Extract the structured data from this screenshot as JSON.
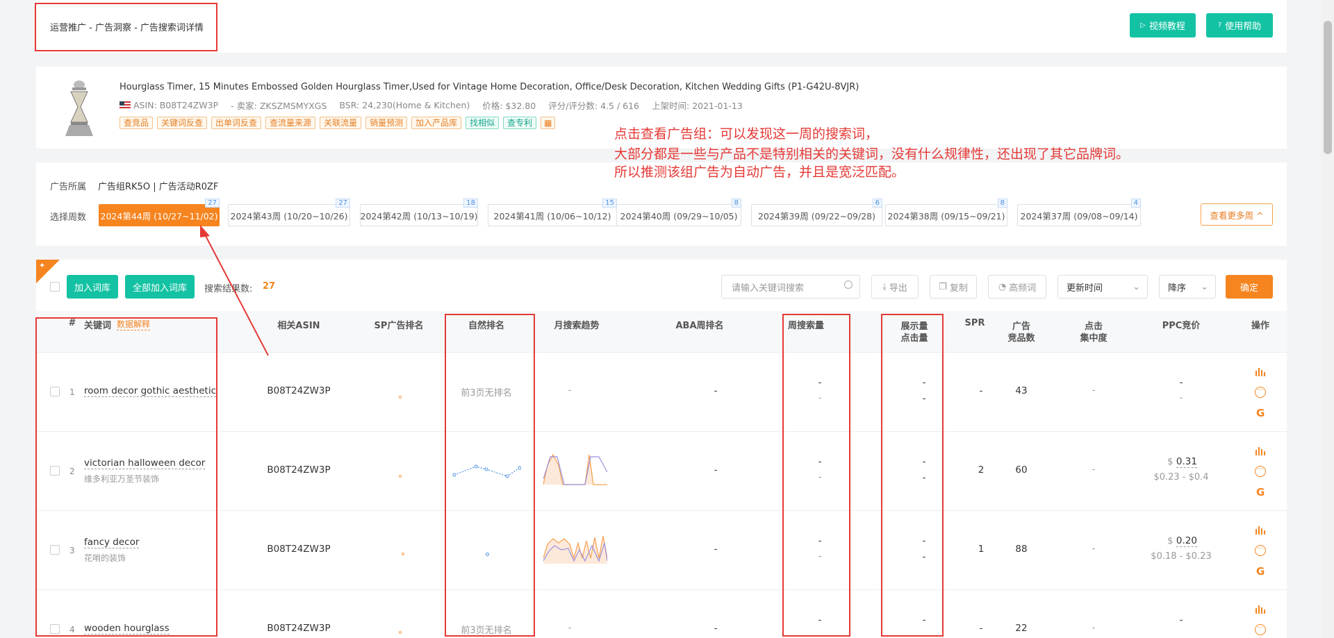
{
  "breadcrumb": "运营推广 - 广告洞察 - 广告搜索词详情",
  "header": {
    "video_btn": "视频教程",
    "help_btn": "使用帮助"
  },
  "product": {
    "title": "Hourglass Timer, 15 Minutes Embossed Golden Hourglass Timer,Used for Vintage Home Decoration, Office/Desk Decoration, Kitchen Wedding Gifts (P1-G42U-8VJR)",
    "asin": "ASIN: B08T24ZW3P",
    "seller": "- 卖家: ZKSZMSMYXGS",
    "bsr": "BSR: 24,230(Home & Kitchen)",
    "price": "价格: $32.80",
    "rating": "评分/评分数: 4.5 / 616",
    "listed": "上架时间: 2021-01-13",
    "tags": [
      "查竞品",
      "关键词反查",
      "出单词反查",
      "查流量来源",
      "关联流量",
      "销量预测",
      "加入产品库"
    ],
    "tags_green": [
      "找相似",
      "查专利"
    ]
  },
  "annotation": {
    "line1": "点击查看广告组：可以发现这一周的搜索词，",
    "line2": "大部分都是一些与产品不是特别相关的关键词，没有什么规律性，还出现了其它品牌词。",
    "line3": "所以推测该组广告为自动广告，并且是宽泛匹配。"
  },
  "ad": {
    "belong_label": "广告所属",
    "belong_value": "广告组RK5O | 广告活动R0ZF",
    "week_label": "选择周数",
    "weeks": [
      {
        "label": "2024第44周 (10/27~11/02)",
        "badge": "27"
      },
      {
        "label": "2024第43周 (10/20~10/26)",
        "badge": "27"
      },
      {
        "label": "2024第42周 (10/13~10/19)",
        "badge": "18"
      },
      {
        "label": "2024第41周 (10/06~10/12)",
        "badge": "15"
      },
      {
        "label": "2024第40周 (09/29~10/05)",
        "badge": "8"
      },
      {
        "label": "2024第39周 (09/22~09/28)",
        "badge": "6"
      },
      {
        "label": "2024第38周 (09/15~09/21)",
        "badge": "8"
      },
      {
        "label": "2024第37周 (09/08~09/14)",
        "badge": "4"
      }
    ],
    "more_weeks": "查看更多周 ^"
  },
  "toolbar": {
    "add_lib": "加入词库",
    "add_all": "全部加入词库",
    "result_label": "搜索结果数:",
    "result_count": "27",
    "search_placeholder": "请输入关键词搜索",
    "export": "导出",
    "copy": "复制",
    "high_freq": "高频词",
    "sort_field": "更新时间",
    "sort_order": "降序",
    "confirm": "确定"
  },
  "table": {
    "headers": {
      "idx": "#",
      "keyword": "关键词",
      "explain": "数据解释",
      "asin": "相关ASIN",
      "sp": "SP广告排名",
      "natural": "自然排名",
      "trend": "月搜索趋势",
      "aba": "ABA周排名",
      "weekly": "周搜索量",
      "impr1": "展示量",
      "impr2": "点击量",
      "spr": "SPR",
      "ad1": "广告",
      "ad2": "竞品数",
      "click1": "点击",
      "click2": "集中度",
      "ppc": "PPC竞价",
      "op": "操作"
    },
    "rows": [
      {
        "idx": "1",
        "kw": "room decor gothic aesthetic",
        "zh": "",
        "asin": "B08T24ZW3P",
        "natural": "前3页无排名",
        "trend": "-",
        "aba": "-",
        "w1": "-",
        "w2": "-",
        "i1": "-",
        "i2": "-",
        "spr": "-",
        "ads": "43",
        "click": "-",
        "ppc": "-",
        "ppc_range": "-"
      },
      {
        "idx": "2",
        "kw": "victorian halloween decor",
        "zh": "维多利亚万圣节装饰",
        "asin": "B08T24ZW3P",
        "natural": "",
        "trend": "",
        "aba": "-",
        "w1": "-",
        "w2": "-",
        "i1": "-",
        "i2": "-",
        "spr": "2",
        "ads": "60",
        "click": "-",
        "ppc": "0.31",
        "ppc_range": "$0.23 - $0.4"
      },
      {
        "idx": "3",
        "kw": "fancy decor",
        "zh": "花哨的装饰",
        "asin": "B08T24ZW3P",
        "natural": "",
        "trend": "",
        "aba": "-",
        "w1": "-",
        "w2": "-",
        "i1": "-",
        "i2": "-",
        "spr": "1",
        "ads": "88",
        "click": "-",
        "ppc": "0.20",
        "ppc_range": "$0.18 - $0.23"
      },
      {
        "idx": "4",
        "kw": "wooden hourglass",
        "zh": "",
        "asin": "B08T24ZW3P",
        "natural": "前3页无排名",
        "trend": "-",
        "aba": "-",
        "w1": "-",
        "w2": "",
        "i1": "-",
        "i2": "",
        "spr": "-",
        "ads": "22",
        "click": "-",
        "ppc": "-",
        "ppc_range": ""
      }
    ],
    "currency": "$"
  }
}
